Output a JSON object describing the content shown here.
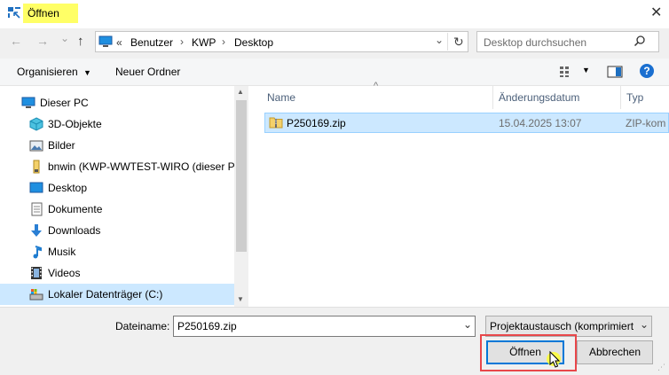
{
  "window": {
    "title": "Öffnen",
    "close_glyph": "✕"
  },
  "nav": {
    "back_glyph": "←",
    "forward_glyph": "→",
    "dropdown_glyph": "⌄",
    "up_glyph": "↑",
    "breadcrumb_overflow": "«",
    "breadcrumb": [
      "Benutzer",
      "KWP",
      "Desktop"
    ],
    "separator_glyph": "›",
    "refresh_glyph": "↻",
    "search_placeholder": "Desktop durchsuchen"
  },
  "toolbar": {
    "organize_label": "Organisieren",
    "new_folder_label": "Neuer Ordner",
    "help_glyph": "?"
  },
  "sidebar": {
    "items": [
      {
        "label": "Dieser PC",
        "icon": "computer-icon"
      },
      {
        "label": "3D-Objekte",
        "icon": "cube-icon"
      },
      {
        "label": "Bilder",
        "icon": "pictures-icon"
      },
      {
        "label": "bnwin (KWP-WWTEST-WIRO (dieser PC)",
        "icon": "usb-drive-icon"
      },
      {
        "label": "Desktop",
        "icon": "desktop-icon"
      },
      {
        "label": "Dokumente",
        "icon": "documents-icon"
      },
      {
        "label": "Downloads",
        "icon": "downloads-icon"
      },
      {
        "label": "Musik",
        "icon": "music-icon"
      },
      {
        "label": "Videos",
        "icon": "videos-icon"
      },
      {
        "label": "Lokaler Datenträger (C:)",
        "icon": "drive-icon"
      }
    ]
  },
  "filelist": {
    "columns": [
      "Name",
      "Änderungsdatum",
      "Typ"
    ],
    "sort_glyph": "^",
    "rows": [
      {
        "name": "P250169.zip",
        "date": "15.04.2025 13:07",
        "type": "ZIP-kom",
        "icon": "zip-folder-icon"
      }
    ]
  },
  "footer": {
    "filename_label": "Dateiname:",
    "filename_value": "P250169.zip",
    "filter_value": "Projektaustausch (komprimiert",
    "open_label": "Öffnen",
    "cancel_label": "Abbrechen"
  },
  "colors": {
    "accent": "#0078d7",
    "selection": "#cce8ff",
    "highlight_box": "#e8474a",
    "title_highlight": "#ffff66"
  }
}
